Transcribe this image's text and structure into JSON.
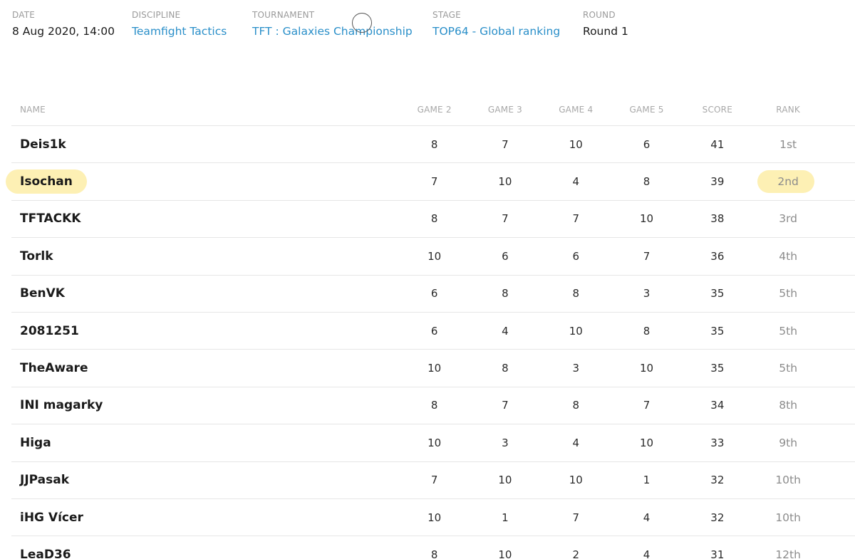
{
  "meta": {
    "date": {
      "label": "DATE",
      "value": "8 Aug 2020, 14:00"
    },
    "discipline": {
      "label": "DISCIPLINE",
      "value": "Teamfight Tactics"
    },
    "tournament": {
      "label": "TOURNAMENT",
      "value": "TFT : Galaxies Championship"
    },
    "stage": {
      "label": "STAGE",
      "value": "TOP64 - Global ranking"
    },
    "round": {
      "label": "ROUND",
      "value": "Round 1"
    }
  },
  "table": {
    "headers": {
      "name": "NAME",
      "game2": "GAME 2",
      "game3": "GAME 3",
      "game4": "GAME 4",
      "game5": "GAME 5",
      "score": "SCORE",
      "rank": "RANK"
    },
    "highlight_color": "#fdf0b4",
    "rows": [
      {
        "name": "Deis1k",
        "g2": "8",
        "g3": "7",
        "g4": "10",
        "g5": "6",
        "score": "41",
        "rank": "1st",
        "highlighted": false
      },
      {
        "name": "Isochan",
        "g2": "7",
        "g3": "10",
        "g4": "4",
        "g5": "8",
        "score": "39",
        "rank": "2nd",
        "highlighted": true
      },
      {
        "name": "TFTACKK",
        "g2": "8",
        "g3": "7",
        "g4": "7",
        "g5": "10",
        "score": "38",
        "rank": "3rd",
        "highlighted": false
      },
      {
        "name": "Torlk",
        "g2": "10",
        "g3": "6",
        "g4": "6",
        "g5": "7",
        "score": "36",
        "rank": "4th",
        "highlighted": false
      },
      {
        "name": "BenVK",
        "g2": "6",
        "g3": "8",
        "g4": "8",
        "g5": "3",
        "score": "35",
        "rank": "5th",
        "highlighted": false
      },
      {
        "name": "2081251",
        "g2": "6",
        "g3": "4",
        "g4": "10",
        "g5": "8",
        "score": "35",
        "rank": "5th",
        "highlighted": false
      },
      {
        "name": "TheAware",
        "g2": "10",
        "g3": "8",
        "g4": "3",
        "g5": "10",
        "score": "35",
        "rank": "5th",
        "highlighted": false
      },
      {
        "name": "INI magarky",
        "g2": "8",
        "g3": "7",
        "g4": "8",
        "g5": "7",
        "score": "34",
        "rank": "8th",
        "highlighted": false
      },
      {
        "name": "Higa",
        "g2": "10",
        "g3": "3",
        "g4": "4",
        "g5": "10",
        "score": "33",
        "rank": "9th",
        "highlighted": false
      },
      {
        "name": "JJPasak",
        "g2": "7",
        "g3": "10",
        "g4": "10",
        "g5": "1",
        "score": "32",
        "rank": "10th",
        "highlighted": false
      },
      {
        "name": "iHG Vícer",
        "g2": "10",
        "g3": "1",
        "g4": "7",
        "g5": "4",
        "score": "32",
        "rank": "10th",
        "highlighted": false
      },
      {
        "name": "LeaD36",
        "g2": "8",
        "g3": "10",
        "g4": "2",
        "g5": "4",
        "score": "31",
        "rank": "12th",
        "highlighted": false
      }
    ]
  }
}
